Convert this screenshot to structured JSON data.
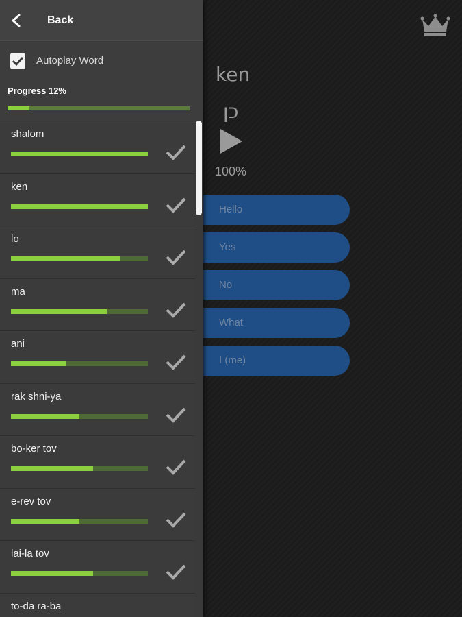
{
  "main": {
    "word": "ken",
    "hebrew": "כן",
    "percent": "100%",
    "answers": [
      "Hello",
      "Yes",
      "No",
      "What",
      "I (me)"
    ],
    "crown_icon": "crown-icon",
    "play_icon": "play-icon"
  },
  "drawer": {
    "back_label": "Back",
    "autoplay_label": "Autoplay Word",
    "autoplay_checked": true,
    "progress_label": "Progress 12%",
    "progress_value": 0.12,
    "items": [
      {
        "label": "shalom",
        "progress": 1.0
      },
      {
        "label": "ken",
        "progress": 1.0
      },
      {
        "label": "lo",
        "progress": 0.8
      },
      {
        "label": "ma",
        "progress": 0.7
      },
      {
        "label": "ani",
        "progress": 0.4
      },
      {
        "label": "rak shni-ya",
        "progress": 0.5
      },
      {
        "label": "bo-ker tov",
        "progress": 0.6
      },
      {
        "label": "e-rev tov",
        "progress": 0.5
      },
      {
        "label": "lai-la tov",
        "progress": 0.6
      },
      {
        "label": "to-da ra-ba",
        "progress": 0.0
      }
    ]
  },
  "colors": {
    "accent_green": "#8bd13f",
    "track_green": "#4f6b35",
    "answer_blue": "#1f4e86"
  }
}
